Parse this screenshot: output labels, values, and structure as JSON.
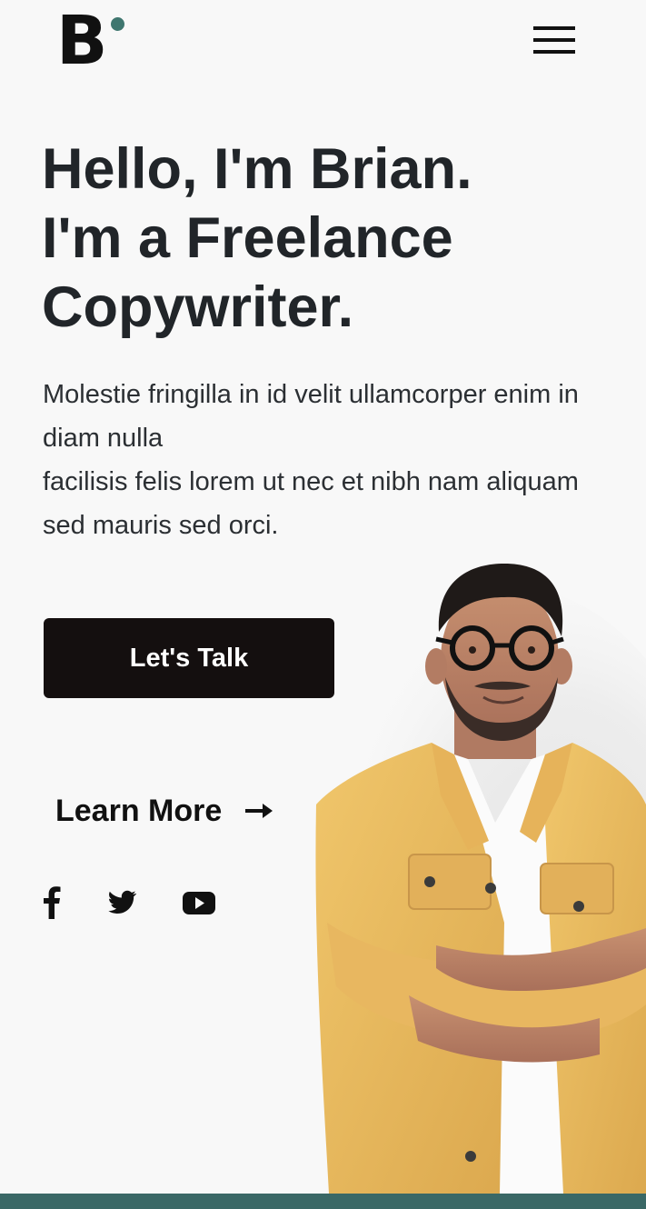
{
  "header": {
    "logo_letter": "B",
    "logo_dot_color": "#3f766f",
    "menu_icon": "hamburger-menu-icon"
  },
  "hero": {
    "title_lines": [
      "Hello, I'm Brian.",
      "I'm a Freelance",
      "Copywriter."
    ],
    "text_lines": [
      "Molestie fringilla in id velit ullamcorper enim in diam nulla",
      "facilisis felis lorem ut nec et nibh nam aliquam sed mauris sed orci."
    ],
    "cta_label": "Let's Talk",
    "learn_more_label": "Learn More",
    "learn_more_icon": "arrow-right-icon",
    "photo": "portrait of a man with glasses in a yellow jacket, arms crossed"
  },
  "socials": [
    {
      "name": "facebook",
      "icon": "facebook-icon"
    },
    {
      "name": "twitter",
      "icon": "twitter-icon"
    },
    {
      "name": "youtube",
      "icon": "youtube-icon"
    }
  ],
  "colors": {
    "background": "#f8f8f8",
    "text": "#212529",
    "button_bg": "#140f0f",
    "button_text": "#ffffff",
    "accent": "#3a6866"
  }
}
